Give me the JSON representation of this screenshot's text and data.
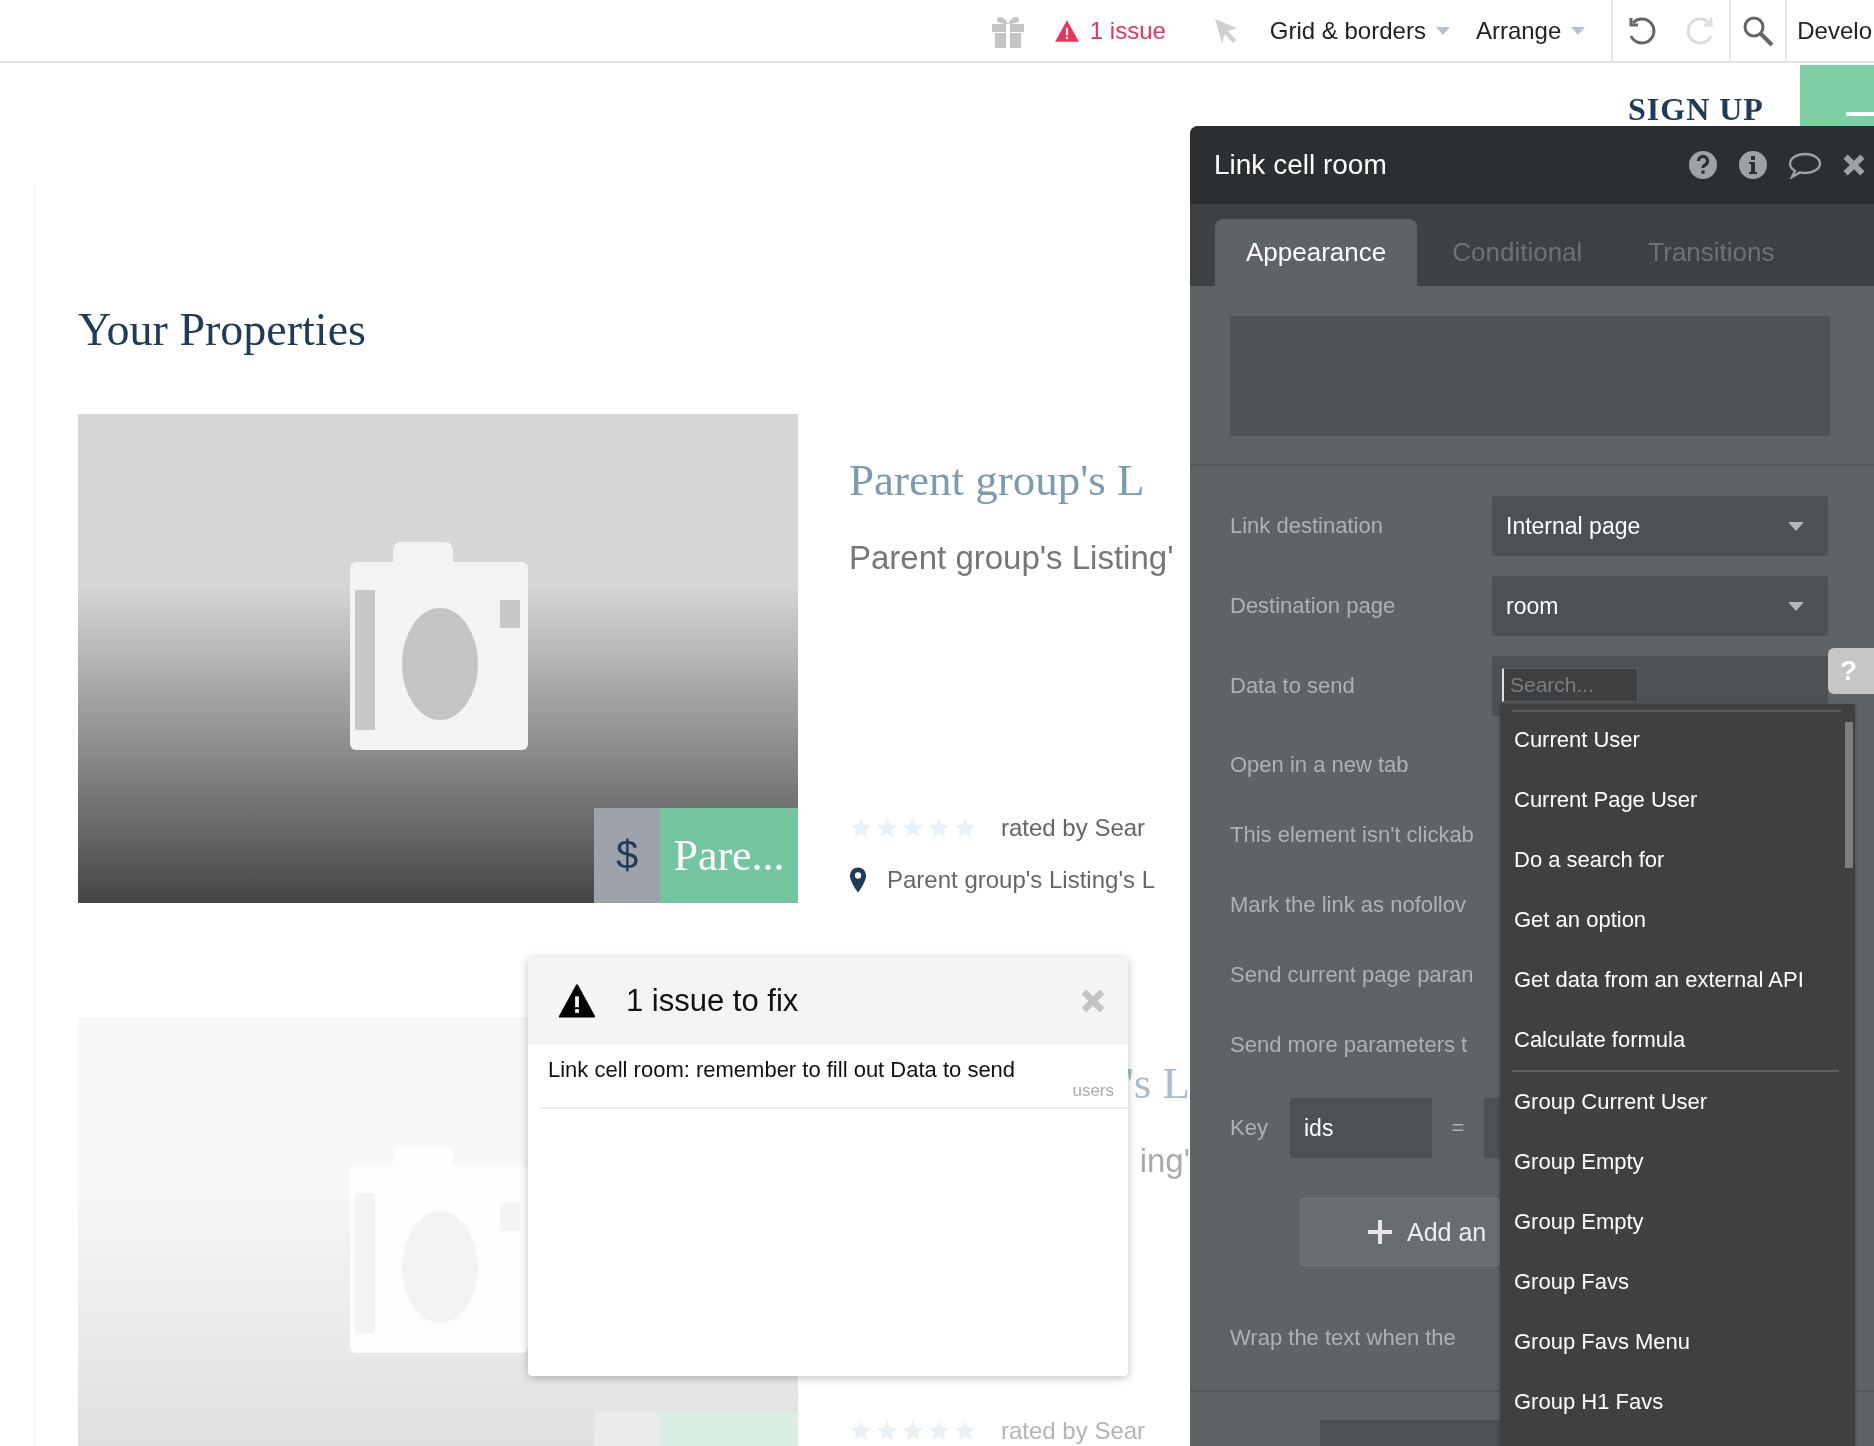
{
  "toolbar": {
    "issues": "1 issue",
    "menus": [
      {
        "label": "Grid & borders"
      },
      {
        "label": "Arrange"
      }
    ],
    "history": [
      {
        "kind": "undo",
        "disabled": false
      },
      {
        "kind": "redo",
        "disabled": true
      }
    ],
    "develop": "Develo"
  },
  "page": {
    "sign_up": "SIGN UP",
    "heading": "Your Properties",
    "listings": [
      {
        "price_symbol": "$",
        "price": "Pare...",
        "title": "Parent group's L",
        "subtitle": "Parent group's Listing'",
        "stars": 0,
        "rated_by": "rated by Sear",
        "location": "Parent group's Listing's L"
      },
      {
        "title": "'s L",
        "subtitle": "ing'",
        "stars": 0,
        "rated_by": "rated by Sear"
      }
    ]
  },
  "property_editor": {
    "title": "Link cell room",
    "tabs": [
      {
        "label": "Appearance",
        "selected": true
      },
      {
        "label": "Conditional",
        "selected": false
      },
      {
        "label": "Transitions",
        "selected": false
      }
    ],
    "fields": [
      {
        "kind": "dropdown",
        "label": "Link destination",
        "value": "Internal page"
      },
      {
        "kind": "dropdown",
        "label": "Destination page",
        "value": "room"
      },
      {
        "kind": "search",
        "label": "Data to send",
        "placeholder": "Search..."
      },
      {
        "kind": "label",
        "label": "Open in a new tab"
      },
      {
        "kind": "label",
        "label": "This element isn't clickab"
      },
      {
        "kind": "label",
        "label": "Mark the link as nofollov"
      },
      {
        "kind": "label",
        "label": "Send current page paran"
      },
      {
        "kind": "label",
        "label": "Send more parameters t"
      }
    ],
    "parameter": {
      "label": "Key",
      "key": "ids",
      "equals": "="
    },
    "add_button": "Add an",
    "wrap_label": "Wrap the text when the",
    "suggestion_groups": [
      {
        "items": [
          "Current User",
          "Current Page User",
          "Do a search for",
          "Get an option",
          "Get data from an external API",
          "Calculate formula"
        ]
      },
      {
        "items": [
          "Group Current User",
          "Group Empty",
          "Group Empty",
          "Group Favs",
          "Group Favs Menu",
          "Group H1 Favs"
        ]
      }
    ]
  },
  "issue_popup": {
    "title": "1 issue to fix",
    "message": "Link cell room: remember to fill out Data to send",
    "tag": "users"
  },
  "help_tab": {
    "label": "?"
  }
}
